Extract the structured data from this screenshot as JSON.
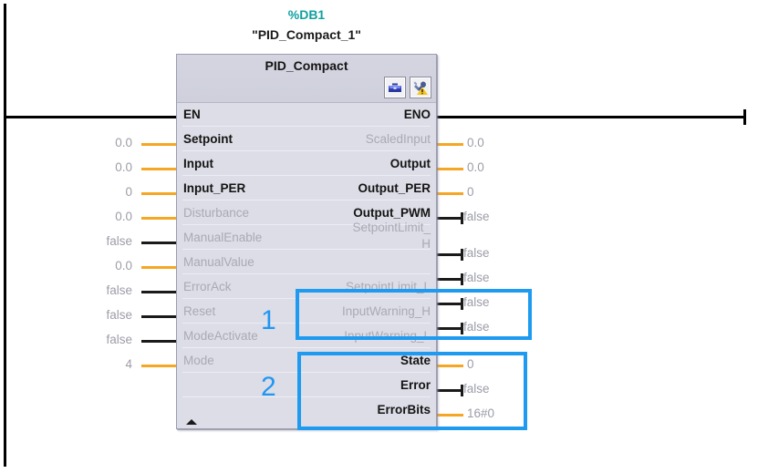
{
  "rung": {
    "db_number": "%DB1",
    "instance_name": "\"PID_Compact_1\"",
    "block_title": "PID_Compact",
    "header_icons": [
      {
        "name": "toolbox-icon",
        "label": "toolbox"
      },
      {
        "name": "tools-warning-icon",
        "label": "tools-warning"
      }
    ],
    "expander_label": "collapse"
  },
  "colors": {
    "accent_teal": "#11a0a0",
    "highlight_blue": "#1e9bf0",
    "annotation_blue": "#2196f3",
    "wire_orange": "#f5a623",
    "wire_black": "#1a1a1a",
    "block_bg": "#dcdde6",
    "dim_text": "#a9aab4"
  },
  "enable": {
    "in_label": "EN",
    "out_label": "ENO"
  },
  "inputs": [
    {
      "label": "Setpoint",
      "value": "0.0",
      "enabled": true,
      "wire": "orange"
    },
    {
      "label": "Input",
      "value": "0.0",
      "enabled": true,
      "wire": "orange"
    },
    {
      "label": "Input_PER",
      "value": "0",
      "enabled": true,
      "wire": "orange"
    },
    {
      "label": "Disturbance",
      "value": "0.0",
      "enabled": false,
      "wire": "orange"
    },
    {
      "label": "ManualEnable",
      "value": "false",
      "enabled": false,
      "wire": "black"
    },
    {
      "label": "ManualValue",
      "value": "0.0",
      "enabled": false,
      "wire": "orange"
    },
    {
      "label": "ErrorAck",
      "value": "false",
      "enabled": false,
      "wire": "black"
    },
    {
      "label": "Reset",
      "value": "false",
      "enabled": false,
      "wire": "black"
    },
    {
      "label": "ModeActivate",
      "value": "false",
      "enabled": false,
      "wire": "black"
    },
    {
      "label": "Mode",
      "value": "4",
      "enabled": false,
      "wire": "orange"
    }
  ],
  "outputs": [
    {
      "label": "ScaledInput",
      "value": "0.0",
      "enabled": false,
      "wire": "orange"
    },
    {
      "label": "Output",
      "value": "0.0",
      "enabled": true,
      "wire": "orange"
    },
    {
      "label": "Output_PER",
      "value": "0",
      "enabled": true,
      "wire": "orange"
    },
    {
      "label": "Output_PWM",
      "value": "false",
      "enabled": true,
      "wire": "bool"
    },
    {
      "label": "SetpointLimit_\nH",
      "value": "false",
      "enabled": false,
      "wire": "bool"
    },
    {
      "label": "SetpointLimit_L",
      "value": "false",
      "enabled": false,
      "wire": "bool"
    },
    {
      "label": "InputWarning_H",
      "value": "false",
      "enabled": false,
      "wire": "bool"
    },
    {
      "label": "InputWarning_L",
      "value": "false",
      "enabled": false,
      "wire": "bool"
    },
    {
      "label": "State",
      "value": "0",
      "enabled": true,
      "wire": "orange"
    },
    {
      "label": "Error",
      "value": "false",
      "enabled": true,
      "wire": "bool"
    },
    {
      "label": "ErrorBits",
      "value": "16#0",
      "enabled": true,
      "wire": "orange"
    }
  ],
  "annotations": [
    {
      "name": "annotation-1",
      "text": "1"
    },
    {
      "name": "annotation-2",
      "text": "2"
    }
  ],
  "highlight_boxes": [
    {
      "name": "highlight-box-input-warnings",
      "covers": [
        "InputWarning_H",
        "InputWarning_L"
      ]
    },
    {
      "name": "highlight-box-error-status",
      "covers": [
        "State",
        "Error",
        "ErrorBits"
      ]
    }
  ]
}
